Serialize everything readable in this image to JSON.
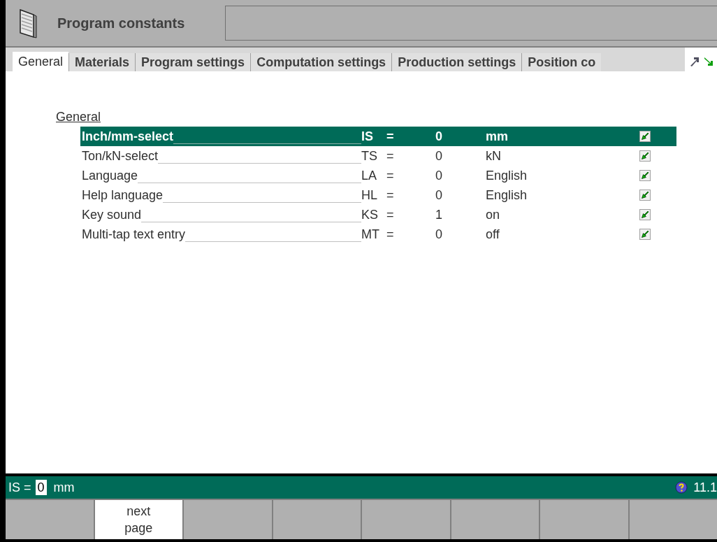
{
  "window": {
    "title": "Program constants"
  },
  "tabs": [
    {
      "label": "General",
      "selected": true
    },
    {
      "label": "Materials",
      "selected": false
    },
    {
      "label": "Program settings",
      "selected": false
    },
    {
      "label": "Computation settings",
      "selected": false
    },
    {
      "label": "Production settings",
      "selected": false
    },
    {
      "label": "Position co",
      "selected": false
    }
  ],
  "section": {
    "title": "General"
  },
  "rows": [
    {
      "label": "Inch/mm-select",
      "code": "IS",
      "equals": "=",
      "value": "0",
      "unit": "mm",
      "selected": true
    },
    {
      "label": "Ton/kN-select",
      "code": "TS",
      "equals": "=",
      "value": "0",
      "unit": "kN",
      "selected": false
    },
    {
      "label": "Language",
      "code": "LA",
      "equals": "=",
      "value": "0",
      "unit": "English",
      "selected": false
    },
    {
      "label": "Help language",
      "code": "HL",
      "equals": "=",
      "value": "0",
      "unit": "English",
      "selected": false
    },
    {
      "label": "Key sound",
      "code": "KS",
      "equals": "=",
      "value": "1",
      "unit": "on",
      "selected": false
    },
    {
      "label": "Multi-tap text entry",
      "code": "MT",
      "equals": "=",
      "value": "0",
      "unit": "off",
      "selected": false
    }
  ],
  "status_bar": {
    "prefix": "IS =",
    "value": "0",
    "unit": "mm",
    "version": "11.1"
  },
  "softkeys": [
    {
      "kind": "blank"
    },
    {
      "kind": "labelled",
      "label": "next page",
      "active": true
    },
    {
      "kind": "blank"
    },
    {
      "kind": "blank"
    },
    {
      "kind": "blank"
    },
    {
      "kind": "blank"
    },
    {
      "kind": "blank"
    },
    {
      "kind": "blank"
    }
  ]
}
